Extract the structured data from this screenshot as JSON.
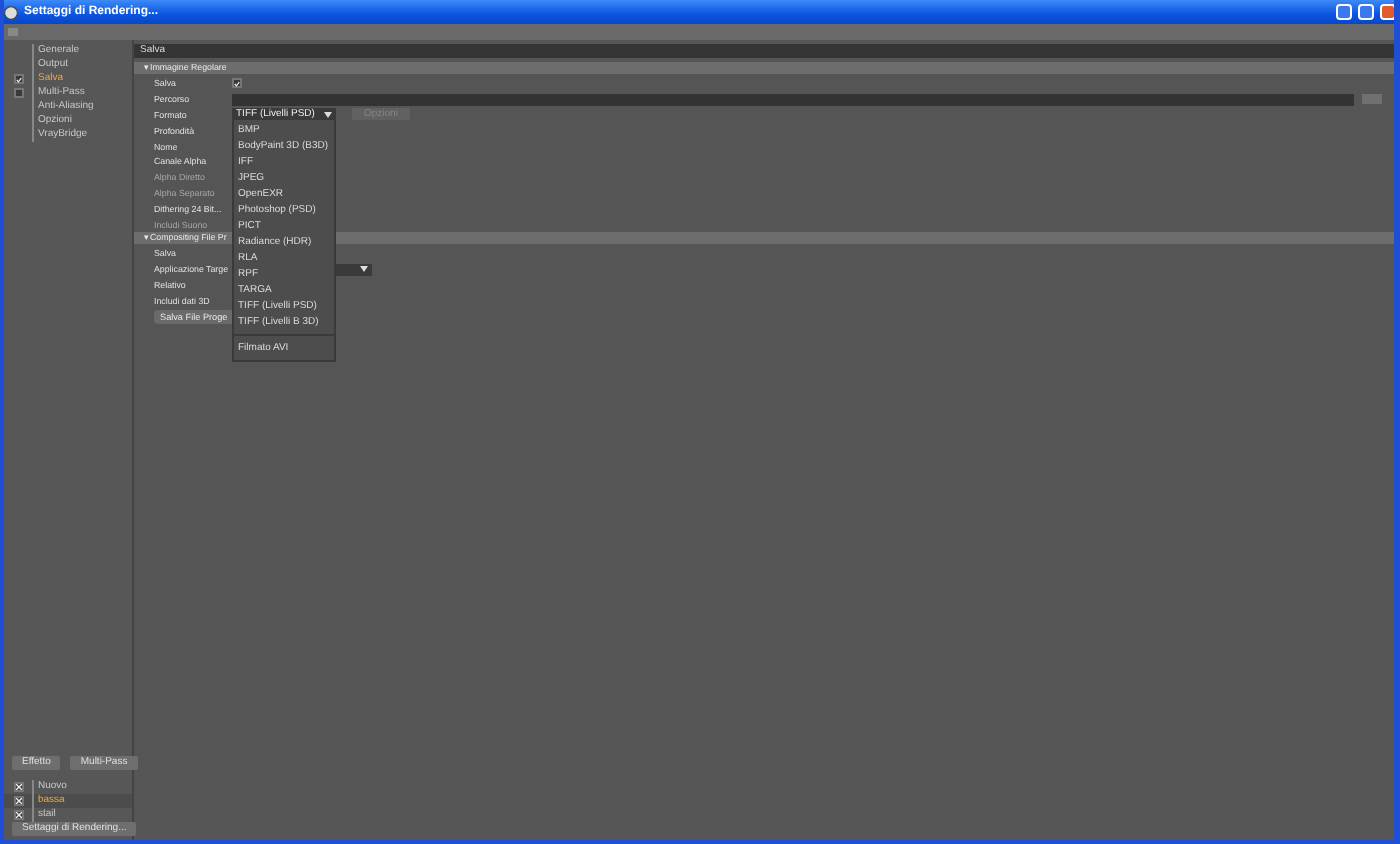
{
  "window": {
    "title": "Settaggi di Rendering..."
  },
  "sidebar": {
    "items": [
      {
        "label": "Generale",
        "kind": "plain",
        "selected": false
      },
      {
        "label": "Output",
        "kind": "plain",
        "selected": false
      },
      {
        "label": "Salva",
        "kind": "check",
        "checked": true,
        "selected": true
      },
      {
        "label": "Multi-Pass",
        "kind": "check",
        "checked": false,
        "selected": false
      },
      {
        "label": "Anti-Aliasing",
        "kind": "plain",
        "selected": false
      },
      {
        "label": "Opzioni",
        "kind": "plain",
        "selected": false
      },
      {
        "label": "VrayBridge",
        "kind": "plain",
        "selected": false
      }
    ],
    "buttons": [
      "Effetto",
      "Multi-Pass"
    ],
    "render_settings": [
      {
        "label": "Nuovo",
        "checked": true,
        "selected": false
      },
      {
        "label": "bassa",
        "checked": true,
        "selected": true
      },
      {
        "label": "stail",
        "checked": true,
        "selected": false
      }
    ],
    "footer_button": "Settaggi di Rendering..."
  },
  "page_header": "Salva",
  "sections": [
    {
      "toggle": "▾",
      "title": "Immagine Regolare",
      "expanded": true,
      "rows": [
        {
          "kind": "check",
          "label": "Salva",
          "checked": true,
          "disabled": false
        },
        {
          "kind": "path",
          "label": "Percorso",
          "disabled": false
        },
        {
          "kind": "select",
          "label": "Formato",
          "value": "TIFF (Livelli PSD)",
          "button": "Opzioni",
          "disabled": false
        },
        {
          "kind": "label",
          "label": "Profondità",
          "disabled": false
        },
        {
          "kind": "label",
          "label": "Nome",
          "disabled": false
        },
        {
          "kind": "label",
          "label": "Canale Alpha",
          "disabled": false
        },
        {
          "kind": "label",
          "label": "Alpha Diretto",
          "disabled": true
        },
        {
          "kind": "label",
          "label": "Alpha Separato",
          "disabled": true
        },
        {
          "kind": "label",
          "label": "Dithering 24 Bit...",
          "disabled": false
        },
        {
          "kind": "label",
          "label": "Includi Suono",
          "disabled": true
        }
      ]
    },
    {
      "toggle": "▾",
      "title": "Compositing File Pr",
      "expanded": true,
      "rows": [
        {
          "kind": "label",
          "label": "Salva",
          "disabled": false
        },
        {
          "kind": "select",
          "label": "Applicazione Targe",
          "disabled": false
        },
        {
          "kind": "label",
          "label": "Relativo",
          "disabled": false
        },
        {
          "kind": "label",
          "label": "Includi dati 3D",
          "disabled": false
        },
        {
          "kind": "button",
          "label": "Salva File Proge"
        }
      ]
    }
  ],
  "format_menu": {
    "open": true,
    "items": [
      {
        "kind": "option",
        "label": "BMP"
      },
      {
        "kind": "option",
        "label": "BodyPaint 3D (B3D)"
      },
      {
        "kind": "option",
        "label": "IFF"
      },
      {
        "kind": "option",
        "label": "JPEG"
      },
      {
        "kind": "option",
        "label": "OpenEXR"
      },
      {
        "kind": "option",
        "label": "Photoshop (PSD)"
      },
      {
        "kind": "option",
        "label": "PICT"
      },
      {
        "kind": "option",
        "label": "Radiance (HDR)"
      },
      {
        "kind": "option",
        "label": "RLA"
      },
      {
        "kind": "option",
        "label": "RPF"
      },
      {
        "kind": "option",
        "label": "TARGA"
      },
      {
        "kind": "option",
        "label": "TIFF (Livelli PSD)"
      },
      {
        "kind": "option",
        "label": "TIFF (Livelli B 3D)"
      },
      {
        "kind": "separator"
      },
      {
        "kind": "option",
        "label": "Filmato AVI"
      }
    ]
  }
}
